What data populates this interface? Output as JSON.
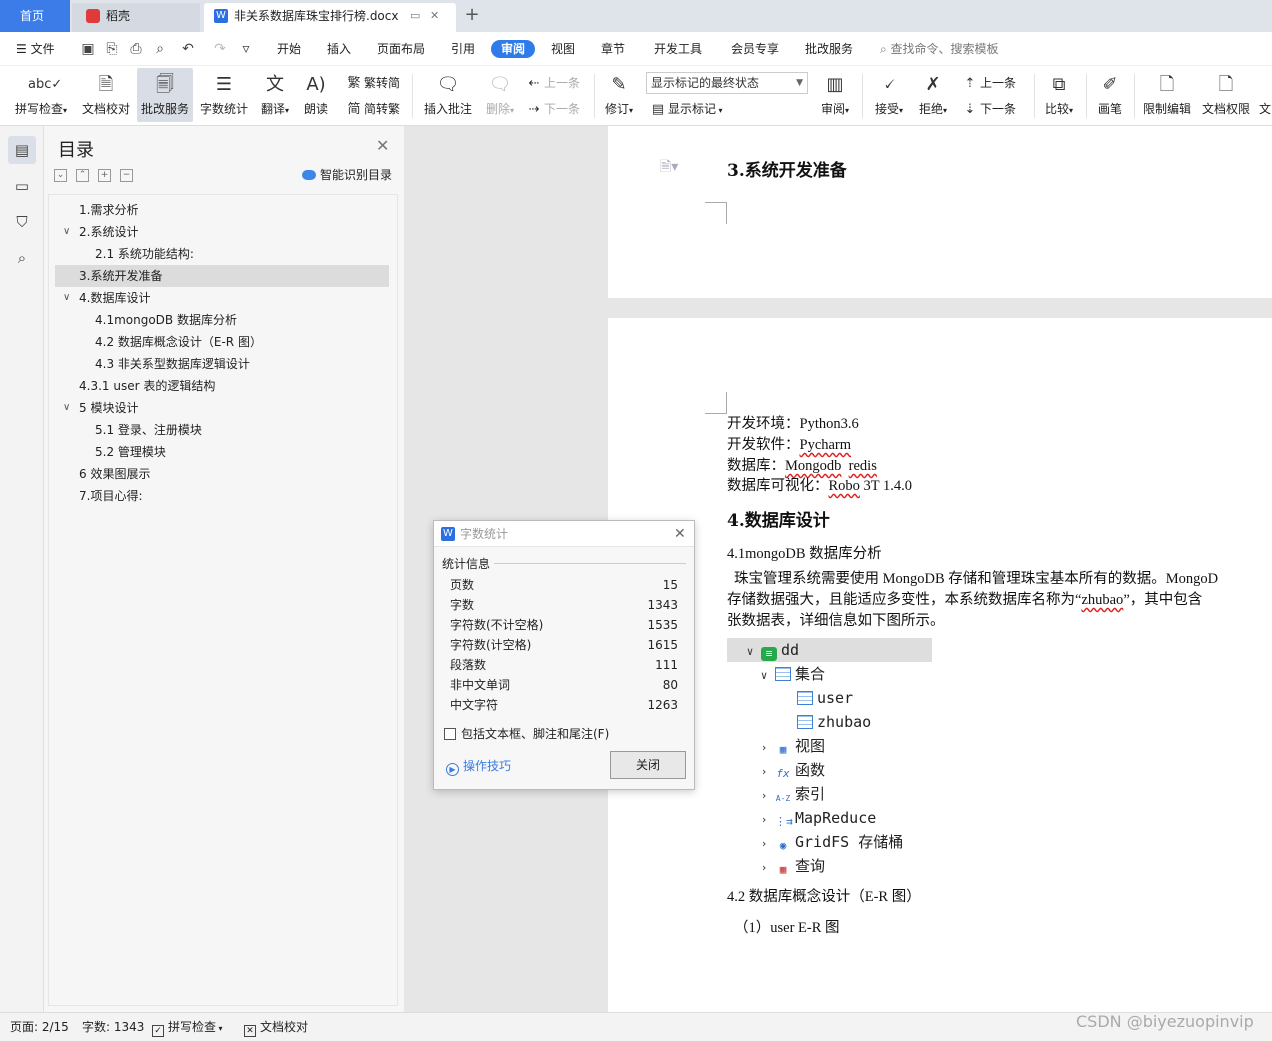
{
  "tabs": {
    "home": "首页",
    "daoke": "稻壳",
    "doc": "非关系数据库珠宝排行榜.docx",
    "add": "+"
  },
  "menu": {
    "file": "文件",
    "items": [
      "开始",
      "插入",
      "页面布局",
      "引用",
      "审阅",
      "视图",
      "章节",
      "开发工具",
      "会员专享",
      "批改服务"
    ],
    "active": "审阅",
    "search": "查找命令、搜索模板"
  },
  "ribbon": {
    "spell": "拼写检查",
    "proof": "文档校对",
    "correct": "批改服务",
    "wordcount": "字数统计",
    "translate": "翻译",
    "read": "朗读",
    "trad": "繁转简",
    "simp": "简转繁",
    "insert_comment": "插入批注",
    "delete": "删除",
    "prev": "上一条",
    "next": "下一条",
    "track": "修订",
    "markup_state": "显示标记的最终状态",
    "show_markup": "显示标记",
    "review": "审阅",
    "accept": "接受",
    "reject": "拒绝",
    "prev2": "上一条",
    "next2": "下一条",
    "compare": "比较",
    "pen": "画笔",
    "restrict": "限制编辑",
    "permission": "文档权限",
    "cut": "文"
  },
  "toc": {
    "title": "目录",
    "smart": "智能识别目录",
    "items": [
      {
        "label": "1.需求分析"
      },
      {
        "label": "2.系统设计"
      },
      {
        "label": "2.1 系统功能结构:"
      },
      {
        "label": "3.系统开发准备"
      },
      {
        "label": "4.数据库设计"
      },
      {
        "label": "4.1mongoDB 数据库分析"
      },
      {
        "label": "4.2 数据库概念设计（E-R 图）"
      },
      {
        "label": "4.3 非关系型数据库逻辑设计"
      },
      {
        "label": "4.3.1 user 表的逻辑结构"
      },
      {
        "label": "5 模块设计"
      },
      {
        "label": "5.1 登录、注册模块"
      },
      {
        "label": "5.2 管理模块"
      },
      {
        "label": "6 效果图展示"
      },
      {
        "label": "7.项目心得:"
      }
    ]
  },
  "doc": {
    "h3": "3.系统开发准备",
    "env_label": "开发环境：",
    "env_value": "Python3.6",
    "soft_label": "开发软件：",
    "soft_value": "Pycharm",
    "db_label": "数据库：",
    "db_value1": "Mongodb",
    "db_value2": "redis",
    "vis_label": "数据库可视化：",
    "vis_value1": "Robo",
    "vis_value2": "3T 1.4.0",
    "h4": "4.数据库设计",
    "s41": "4.1mongoDB 数据库分析",
    "para1": "珠宝管理系统需要使用 MongoDB 存储和管理珠宝基本所有的数据。MongoD",
    "para2a": "存储数据强大，且能适应多变性，本系统数据库名称为“",
    "para2b": "zhubao",
    "para2c": "”，其中包含",
    "para3": "张数据表，详细信息如下图所示。",
    "s42": "4.2 数据库概念设计（E-R 图）",
    "s42a": "（1）user E-R 图"
  },
  "tree": {
    "root": "dd",
    "collections": "集合",
    "user": "user",
    "zhubao": "zhubao",
    "views": "视图",
    "functions": "函数",
    "index": "索引",
    "mapreduce": "MapReduce",
    "gridfs": "GridFS 存储桶",
    "query": "查询"
  },
  "dialog": {
    "title": "字数统计",
    "group": "统计信息",
    "rows": [
      {
        "label": "页数",
        "value": "15"
      },
      {
        "label": "字数",
        "value": "1343"
      },
      {
        "label": "字符数(不计空格)",
        "value": "1535"
      },
      {
        "label": "字符数(计空格)",
        "value": "1615"
      },
      {
        "label": "段落数",
        "value": "111"
      },
      {
        "label": "非中文单词",
        "value": "80"
      },
      {
        "label": "中文字符",
        "value": "1263"
      }
    ],
    "check": "包括文本框、脚注和尾注(F)",
    "tips": "操作技巧",
    "close": "关闭"
  },
  "status": {
    "page": "页面: 2/15",
    "words": "字数: 1343",
    "spell": "拼写检查",
    "proof": "文档校对"
  },
  "watermark": "CSDN @biyezuopinvip"
}
